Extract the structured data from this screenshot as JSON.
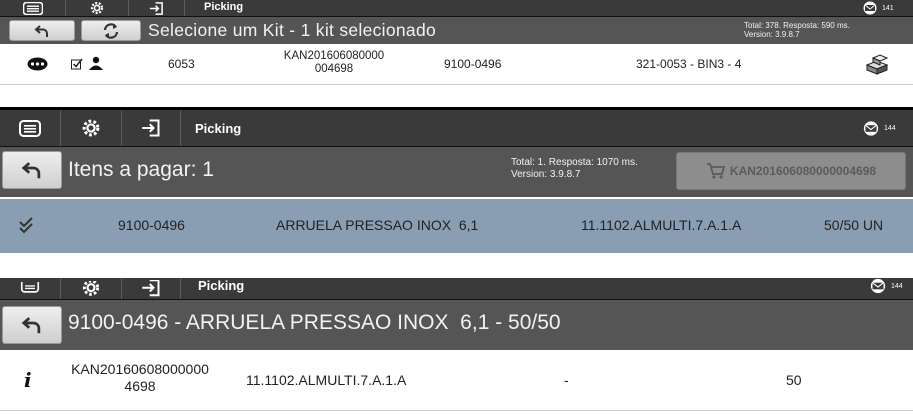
{
  "colors": {
    "toolbar_bg": "#3a3a3a",
    "subbar_bg": "#555555",
    "selected_row_bg": "#8a9eb3",
    "cart_button_bg": "#8d8d8d",
    "cart_button_text": "#5b5b5b"
  },
  "toolbar": {
    "menu_icon": "menu-icon",
    "settings_icon": "gear-icon",
    "login_icon": "login-icon",
    "title": "Picking",
    "mail_icon": "mail-icon"
  },
  "panel1": {
    "badge": "141",
    "back_icon": "back-arrow-icon",
    "refresh_icon": "refresh-icon",
    "title": "Selecione um Kit - 1 kit selecionado",
    "stats_line1": "Total: 378. Resposta: 590 ms.",
    "stats_line2": "Version: 3.9.8.7",
    "row": {
      "number": "6053",
      "kanban_line1": "KAN201606080000",
      "kanban_line2": "004698",
      "item": "9100-0496",
      "location": "321-0053 - BIN3 - 4"
    }
  },
  "panel2": {
    "badge": "144",
    "title": "Itens a pagar: 1",
    "stats_line1": "Total: 1. Resposta: 1070 ms.",
    "stats_line2": "Version: 3.9.8.7",
    "cart_label": "KAN201606080000004698",
    "row": {
      "item": "9100-0496",
      "description": "ARRUELA PRESSAO INOX  6,1",
      "location": "11.1102.ALMULTI.7.A.1.A",
      "quantity": "50/50 UN"
    }
  },
  "panel3": {
    "badge": "144",
    "title": "9100-0496 - ARRUELA PRESSAO INOX  6,1 - 50/50",
    "row": {
      "info_icon": "info-icon",
      "kanban_line1": "KAN20160608000000",
      "kanban_line2": "4698",
      "location": "11.1102.ALMULTI.7.A.1.A",
      "dash": "-",
      "quantity": "50"
    }
  }
}
